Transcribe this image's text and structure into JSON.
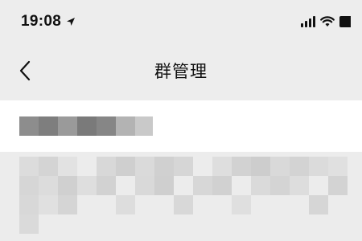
{
  "status_bar": {
    "time": "19:08",
    "location_icon": "location-arrow-icon",
    "signal_icon": "cellular-signal-icon",
    "wifi_icon": "wifi-icon",
    "battery_icon": "battery-icon"
  },
  "nav_bar": {
    "back_icon": "chevron-left-icon",
    "title": "群管理"
  },
  "colors": {
    "background": "#ededed",
    "row_background": "#ffffff",
    "text": "#111111"
  }
}
